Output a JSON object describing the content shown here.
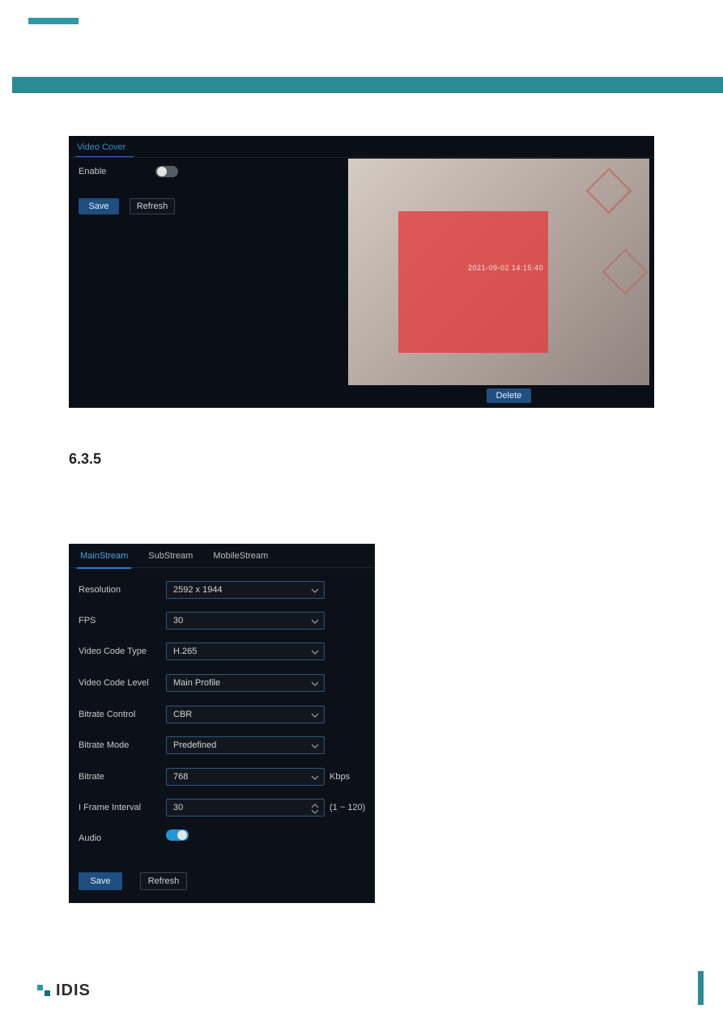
{
  "section_number": "6.3.5",
  "panel1": {
    "tab_label": "Video Cover",
    "enable_label": "Enable",
    "enable_state": false,
    "save_label": "Save",
    "refresh_label": "Refresh",
    "delete_label": "Delete",
    "timestamp_overlay": "2021-09-02 14:15:40"
  },
  "panel2": {
    "tabs": [
      {
        "label": "MainStream",
        "active": true
      },
      {
        "label": "SubStream",
        "active": false
      },
      {
        "label": "MobileStream",
        "active": false
      }
    ],
    "rows": {
      "resolution": {
        "label": "Resolution",
        "value": "2592 x 1944"
      },
      "fps": {
        "label": "FPS",
        "value": "30"
      },
      "video_code_type": {
        "label": "Video Code Type",
        "value": "H.265"
      },
      "video_code_level": {
        "label": "Video Code Level",
        "value": "Main Profile"
      },
      "bitrate_control": {
        "label": "Bitrate Control",
        "value": "CBR"
      },
      "bitrate_mode": {
        "label": "Bitrate Mode",
        "value": "Predefined"
      },
      "bitrate": {
        "label": "Bitrate",
        "value": "768",
        "unit": "Kbps"
      },
      "iframe": {
        "label": "I Frame Interval",
        "value": "30",
        "range": "(1 ~ 120)"
      },
      "audio": {
        "label": "Audio",
        "state": true
      }
    },
    "save_label": "Save",
    "refresh_label": "Refresh"
  },
  "footer": {
    "brand": "IDIS"
  }
}
